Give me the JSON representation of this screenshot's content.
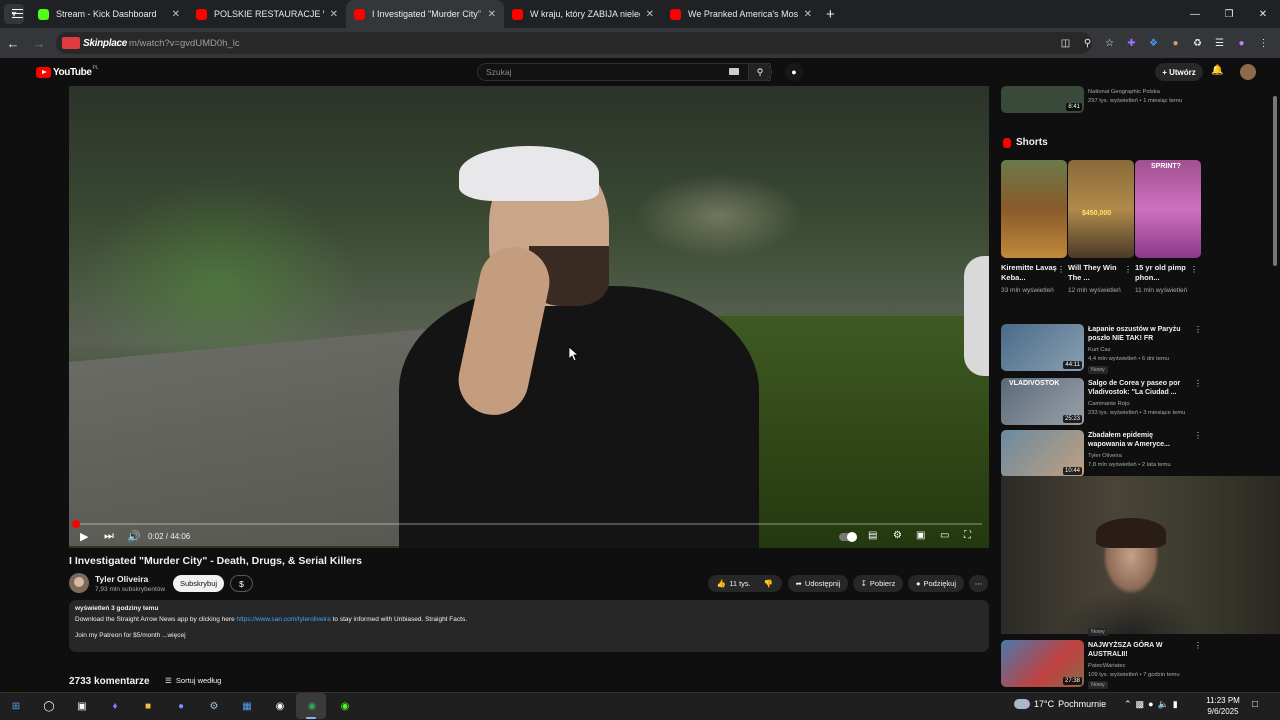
{
  "browser": {
    "tabs": [
      {
        "title": "Stream - Kick Dashboard",
        "color": "#53fc18",
        "active": false
      },
      {
        "title": "POLSKIE RESTAURACJE W USA",
        "color": "#ff0000",
        "active": false
      },
      {
        "title": "I Investigated \"Murder City\" - D",
        "color": "#ff0000",
        "active": true
      },
      {
        "title": "W kraju, który ZABIJA nielegalny",
        "color": "#ff0000",
        "active": false
      },
      {
        "title": "We Pranked America's Most Ra",
        "color": "#ff0000",
        "active": false
      }
    ],
    "address_brand": "Skinplace",
    "address_url": "m/watch?v=gvdUMD0h_lc"
  },
  "youtube": {
    "logo_text": "YouTube",
    "country_code": "PL",
    "search_placeholder": "Szukaj",
    "create_label": "Utwórz"
  },
  "video": {
    "title": "I Investigated \"Murder City\" - Death, Drugs, & Serial Killers",
    "time_current": "0:02",
    "time_total": "44:06",
    "time_display": "0:02 / 44:06",
    "progress": 0.001,
    "channel": "Tyler Oliveira",
    "subscribers": "7,93 mln subskrybentów",
    "subscribe_label": "Subskrybuj",
    "donate_label": "$",
    "likes": "11 tys.",
    "share_label": "Udostępnij",
    "download_label": "Pobierz",
    "thanks_label": "Podziękuj",
    "description": {
      "views_line": "wyświetleń  3 godziny temu",
      "line2_pre": "Download the Straight Arrow News app by clicking here ",
      "line2_link": "https://www.san.com/tyleroliveira",
      "line2_post": " to stay informed with Unbiased. Straight Facts.",
      "line3": "Join my Patreon for $5/month  ...więcej"
    },
    "comments_count": "2733 komentarze",
    "sort_label": "Sortuj według"
  },
  "sidebar": {
    "top_item": {
      "channel": "National Geographic Polska",
      "meta": "297 tys. wyświetleń • 1 miesiąc temu",
      "duration": "8:41"
    },
    "shorts_heading": "Shorts",
    "shorts": [
      {
        "title": "Kiremitte Lavaş Keba...",
        "views": "33 mln wyświetleń",
        "color": "#7a5a2c"
      },
      {
        "title": "Will They Win The ...",
        "views": "12 mln wyświetleń",
        "color": "#8b6a3c",
        "overlay": "$450,000"
      },
      {
        "title": "15 yr old pimp phon...",
        "views": "11 mln wyświetleń",
        "color": "#c060b0",
        "overlay": "SPRINT?"
      }
    ],
    "videos": [
      {
        "title": "Łapanie oszustów w Paryżu poszło NIE TAK! FR",
        "channel": "Kurt Caz",
        "meta": "4,4 mln wyświetleń • 6 dni temu",
        "badge": "Nowy",
        "duration": "44:11",
        "color": "#4a6a8a"
      },
      {
        "title": "Salgo de Corea y paseo por Vladivostok: \"La Ciudad ...",
        "channel": "Caminante Rojo",
        "meta": "233 tys. wyświetleń • 3 miesiące temu",
        "badge": "",
        "duration": "25:23",
        "color": "#5a6a7a",
        "overlay": "VLADIVOSTOK"
      },
      {
        "title": "Zbadałem epidemię wapowania w Ameryce...",
        "channel": "Tyler Oliveira",
        "meta": "7,8 mln wyświetleń • 2 lata temu",
        "badge": "",
        "duration": "10:44",
        "color": "#6a8aa0"
      },
      {
        "title": "NAJWYŻSZA GÓRA W AUSTRALII!",
        "channel": "PatecWariatec",
        "meta": "109 tys. wyświetleń • 7 godzin temu",
        "badge": "Nowy",
        "duration": "27:38",
        "color": "#4a7aaa"
      }
    ],
    "hidden_badge": "Nowy"
  },
  "taskbar": {
    "temperature": "17°C",
    "weather": "Pochmurnie",
    "time": "11:23 PM",
    "date": "9/6/2025"
  }
}
